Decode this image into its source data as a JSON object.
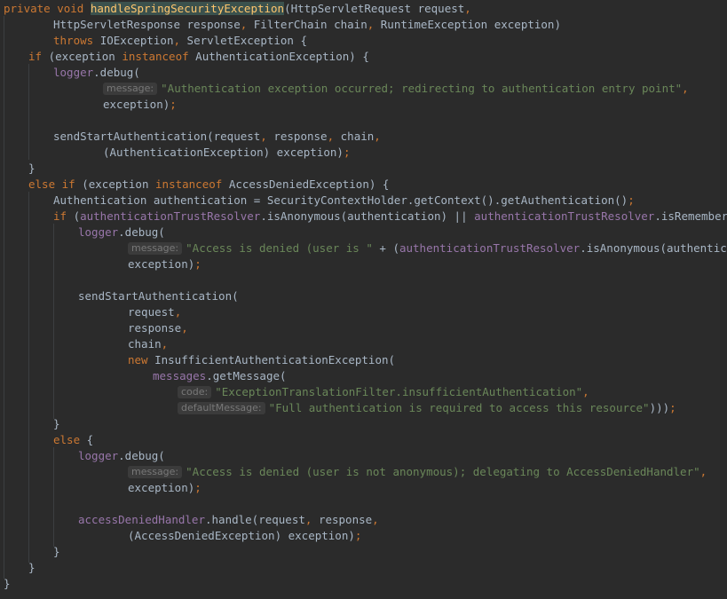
{
  "editor": {
    "lines": [
      {
        "indent": 0,
        "tokens": [
          {
            "t": "private void ",
            "c": "kw"
          },
          {
            "t": "handleSpringSecurityException",
            "c": "fn hl"
          },
          {
            "t": "(HttpServletRequest request",
            "c": "pl"
          },
          {
            "t": ",",
            "c": "kw"
          }
        ]
      },
      {
        "indent": 8,
        "tokens": [
          {
            "t": "HttpServletResponse response",
            "c": "pl"
          },
          {
            "t": ", ",
            "c": "kw"
          },
          {
            "t": "FilterChain chain",
            "c": "pl"
          },
          {
            "t": ", ",
            "c": "kw"
          },
          {
            "t": "RuntimeException exception)",
            "c": "pl"
          }
        ]
      },
      {
        "indent": 8,
        "tokens": [
          {
            "t": "throws ",
            "c": "kw"
          },
          {
            "t": "IOException",
            "c": "pl"
          },
          {
            "t": ", ",
            "c": "kw"
          },
          {
            "t": "ServletException {",
            "c": "pl"
          }
        ]
      },
      {
        "indent": 4,
        "tokens": [
          {
            "t": "if ",
            "c": "kw"
          },
          {
            "t": "(exception ",
            "c": "pl"
          },
          {
            "t": "instanceof ",
            "c": "kw"
          },
          {
            "t": "AuthenticationException) {",
            "c": "pl"
          }
        ]
      },
      {
        "indent": 8,
        "tokens": [
          {
            "t": "logger",
            "c": "fld"
          },
          {
            "t": ".debug(",
            "c": "pl"
          }
        ]
      },
      {
        "indent": 16,
        "tokens": [
          {
            "t": "message:",
            "c": "hint"
          },
          {
            "t": "\"Authentication exception occurred; redirecting to authentication entry point\"",
            "c": "str"
          },
          {
            "t": ",",
            "c": "kw"
          }
        ]
      },
      {
        "indent": 16,
        "tokens": [
          {
            "t": "exception)",
            "c": "pl"
          },
          {
            "t": ";",
            "c": "kw"
          }
        ]
      },
      {
        "indent": 0,
        "tokens": []
      },
      {
        "indent": 8,
        "tokens": [
          {
            "t": "sendStartAuthentication(request",
            "c": "pl"
          },
          {
            "t": ", ",
            "c": "kw"
          },
          {
            "t": "response",
            "c": "pl"
          },
          {
            "t": ", ",
            "c": "kw"
          },
          {
            "t": "chain",
            "c": "pl"
          },
          {
            "t": ",",
            "c": "kw"
          }
        ]
      },
      {
        "indent": 16,
        "tokens": [
          {
            "t": "(AuthenticationException) exception)",
            "c": "pl"
          },
          {
            "t": ";",
            "c": "kw"
          }
        ]
      },
      {
        "indent": 4,
        "tokens": [
          {
            "t": "}",
            "c": "pl"
          }
        ]
      },
      {
        "indent": 4,
        "tokens": [
          {
            "t": "else if ",
            "c": "kw"
          },
          {
            "t": "(exception ",
            "c": "pl"
          },
          {
            "t": "instanceof ",
            "c": "kw"
          },
          {
            "t": "AccessDeniedException) {",
            "c": "pl"
          }
        ]
      },
      {
        "indent": 8,
        "tokens": [
          {
            "t": "Authentication authentication = SecurityContextHolder.getContext().getAuthentication()",
            "c": "pl"
          },
          {
            "t": ";",
            "c": "kw"
          }
        ]
      },
      {
        "indent": 8,
        "tokens": [
          {
            "t": "if ",
            "c": "kw"
          },
          {
            "t": "(",
            "c": "pl"
          },
          {
            "t": "authenticationTrustResolver",
            "c": "fld"
          },
          {
            "t": ".isAnonymous(authentication) || ",
            "c": "pl"
          },
          {
            "t": "authenticationTrustResolver",
            "c": "fld"
          },
          {
            "t": ".isRememberMe(authentication)) {",
            "c": "pl"
          }
        ]
      },
      {
        "indent": 12,
        "tokens": [
          {
            "t": "logger",
            "c": "fld"
          },
          {
            "t": ".debug(",
            "c": "pl"
          }
        ]
      },
      {
        "indent": 20,
        "tokens": [
          {
            "t": "message:",
            "c": "hint"
          },
          {
            "t": "\"Access is denied (user is \"",
            "c": "str"
          },
          {
            "t": " + (",
            "c": "pl"
          },
          {
            "t": "authenticationTrustResolver",
            "c": "fld"
          },
          {
            "t": ".isAnonymous(authentication) ? \"anonymous\" : \"not fully authenticated\") + \")",
            "c": "pl"
          }
        ]
      },
      {
        "indent": 20,
        "tokens": [
          {
            "t": "exception)",
            "c": "pl"
          },
          {
            "t": ";",
            "c": "kw"
          }
        ]
      },
      {
        "indent": 0,
        "tokens": []
      },
      {
        "indent": 12,
        "tokens": [
          {
            "t": "sendStartAuthentication(",
            "c": "pl"
          }
        ]
      },
      {
        "indent": 20,
        "tokens": [
          {
            "t": "request",
            "c": "pl"
          },
          {
            "t": ",",
            "c": "kw"
          }
        ]
      },
      {
        "indent": 20,
        "tokens": [
          {
            "t": "response",
            "c": "pl"
          },
          {
            "t": ",",
            "c": "kw"
          }
        ]
      },
      {
        "indent": 20,
        "tokens": [
          {
            "t": "chain",
            "c": "pl"
          },
          {
            "t": ",",
            "c": "kw"
          }
        ]
      },
      {
        "indent": 20,
        "tokens": [
          {
            "t": "new ",
            "c": "kw"
          },
          {
            "t": "InsufficientAuthenticationException(",
            "c": "pl"
          }
        ]
      },
      {
        "indent": 24,
        "tokens": [
          {
            "t": "messages",
            "c": "fld"
          },
          {
            "t": ".getMessage(",
            "c": "pl"
          }
        ]
      },
      {
        "indent": 28,
        "tokens": [
          {
            "t": "code:",
            "c": "hint"
          },
          {
            "t": "\"ExceptionTranslationFilter.insufficientAuthentication\"",
            "c": "str"
          },
          {
            "t": ",",
            "c": "kw"
          }
        ]
      },
      {
        "indent": 28,
        "tokens": [
          {
            "t": "defaultMessage:",
            "c": "hint"
          },
          {
            "t": "\"Full authentication is required to access this resource\"",
            "c": "str"
          },
          {
            "t": ")))",
            "c": "pl"
          },
          {
            "t": ";",
            "c": "kw"
          }
        ]
      },
      {
        "indent": 8,
        "tokens": [
          {
            "t": "}",
            "c": "pl"
          }
        ]
      },
      {
        "indent": 8,
        "tokens": [
          {
            "t": "else ",
            "c": "kw"
          },
          {
            "t": "{",
            "c": "pl"
          }
        ]
      },
      {
        "indent": 12,
        "tokens": [
          {
            "t": "logger",
            "c": "fld"
          },
          {
            "t": ".debug(",
            "c": "pl"
          }
        ]
      },
      {
        "indent": 20,
        "tokens": [
          {
            "t": "message:",
            "c": "hint"
          },
          {
            "t": "\"Access is denied (user is not anonymous); delegating to AccessDeniedHandler\"",
            "c": "str"
          },
          {
            "t": ",",
            "c": "kw"
          }
        ]
      },
      {
        "indent": 20,
        "tokens": [
          {
            "t": "exception)",
            "c": "pl"
          },
          {
            "t": ";",
            "c": "kw"
          }
        ]
      },
      {
        "indent": 0,
        "tokens": []
      },
      {
        "indent": 12,
        "tokens": [
          {
            "t": "accessDeniedHandler",
            "c": "fld"
          },
          {
            "t": ".handle(request",
            "c": "pl"
          },
          {
            "t": ", ",
            "c": "kw"
          },
          {
            "t": "response",
            "c": "pl"
          },
          {
            "t": ",",
            "c": "kw"
          }
        ]
      },
      {
        "indent": 20,
        "tokens": [
          {
            "t": "(AccessDeniedException) exception)",
            "c": "pl"
          },
          {
            "t": ";",
            "c": "kw"
          }
        ]
      },
      {
        "indent": 8,
        "tokens": [
          {
            "t": "}",
            "c": "pl"
          }
        ]
      },
      {
        "indent": 4,
        "tokens": [
          {
            "t": "}",
            "c": "pl"
          }
        ]
      },
      {
        "indent": 0,
        "tokens": [
          {
            "t": "}",
            "c": "pl"
          }
        ]
      }
    ]
  },
  "colors": {
    "background": "#2b2b2b",
    "keyword": "#cc7832",
    "method_declaration": "#ffc66d",
    "string": "#6a8759",
    "field": "#9876aa",
    "plain": "#a9b7c6",
    "inlay_hint": "#787878"
  }
}
